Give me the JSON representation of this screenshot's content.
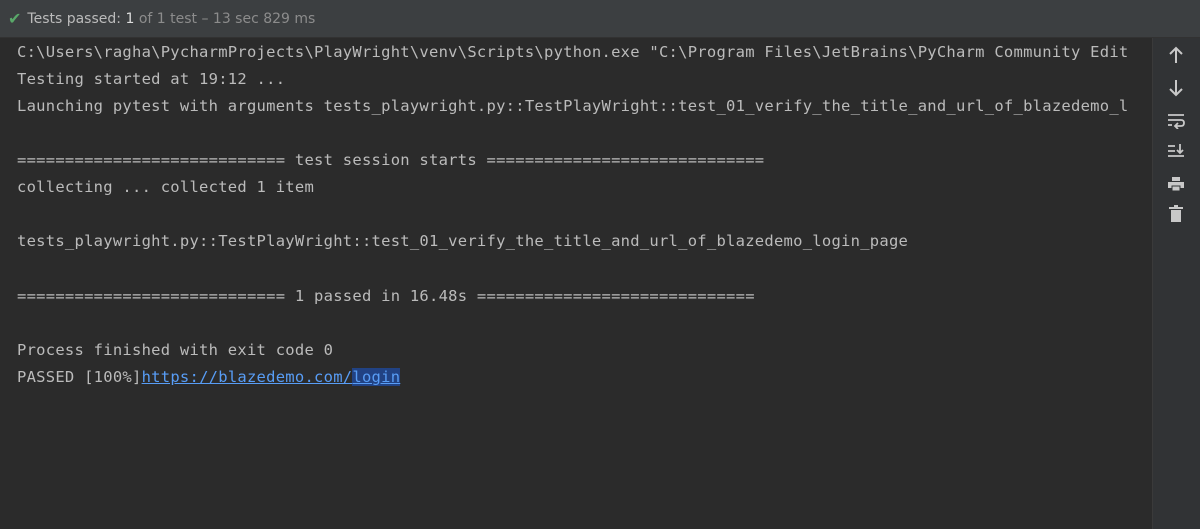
{
  "status": {
    "label": "Tests passed:",
    "passed_count": "1",
    "of_total": "of 1 test",
    "separator": "–",
    "duration": "13 sec 829 ms"
  },
  "console": {
    "lines": [
      "C:\\Users\\ragha\\PycharmProjects\\PlayWright\\venv\\Scripts\\python.exe \"C:\\Program Files\\JetBrains\\PyCharm Community Edit",
      "Testing started at 19:12 ...",
      "Launching pytest with arguments tests_playwright.py::TestPlayWright::test_01_verify_the_title_and_url_of_blazedemo_l",
      "============================ test session starts =============================",
      "collecting ... collected 1 item",
      "tests_playwright.py::TestPlayWright::test_01_verify_the_title_and_url_of_blazedemo_login_page",
      "============================ 1 passed in 16.48s =============================",
      "Process finished with exit code 0"
    ],
    "result_prefix": "PASSED [100%]",
    "result_link_base": "https://blazedemo.com/",
    "result_link_selected": "login"
  },
  "gutter": {
    "icons": [
      "arrow-up-icon",
      "arrow-down-icon",
      "soft-wrap-icon",
      "scroll-to-end-icon",
      "print-icon",
      "trash-icon"
    ]
  },
  "colors": {
    "background": "#2b2b2b",
    "status_bar": "#3c3f41",
    "success": "#59a869",
    "link": "#589df6",
    "selection": "#214283"
  }
}
